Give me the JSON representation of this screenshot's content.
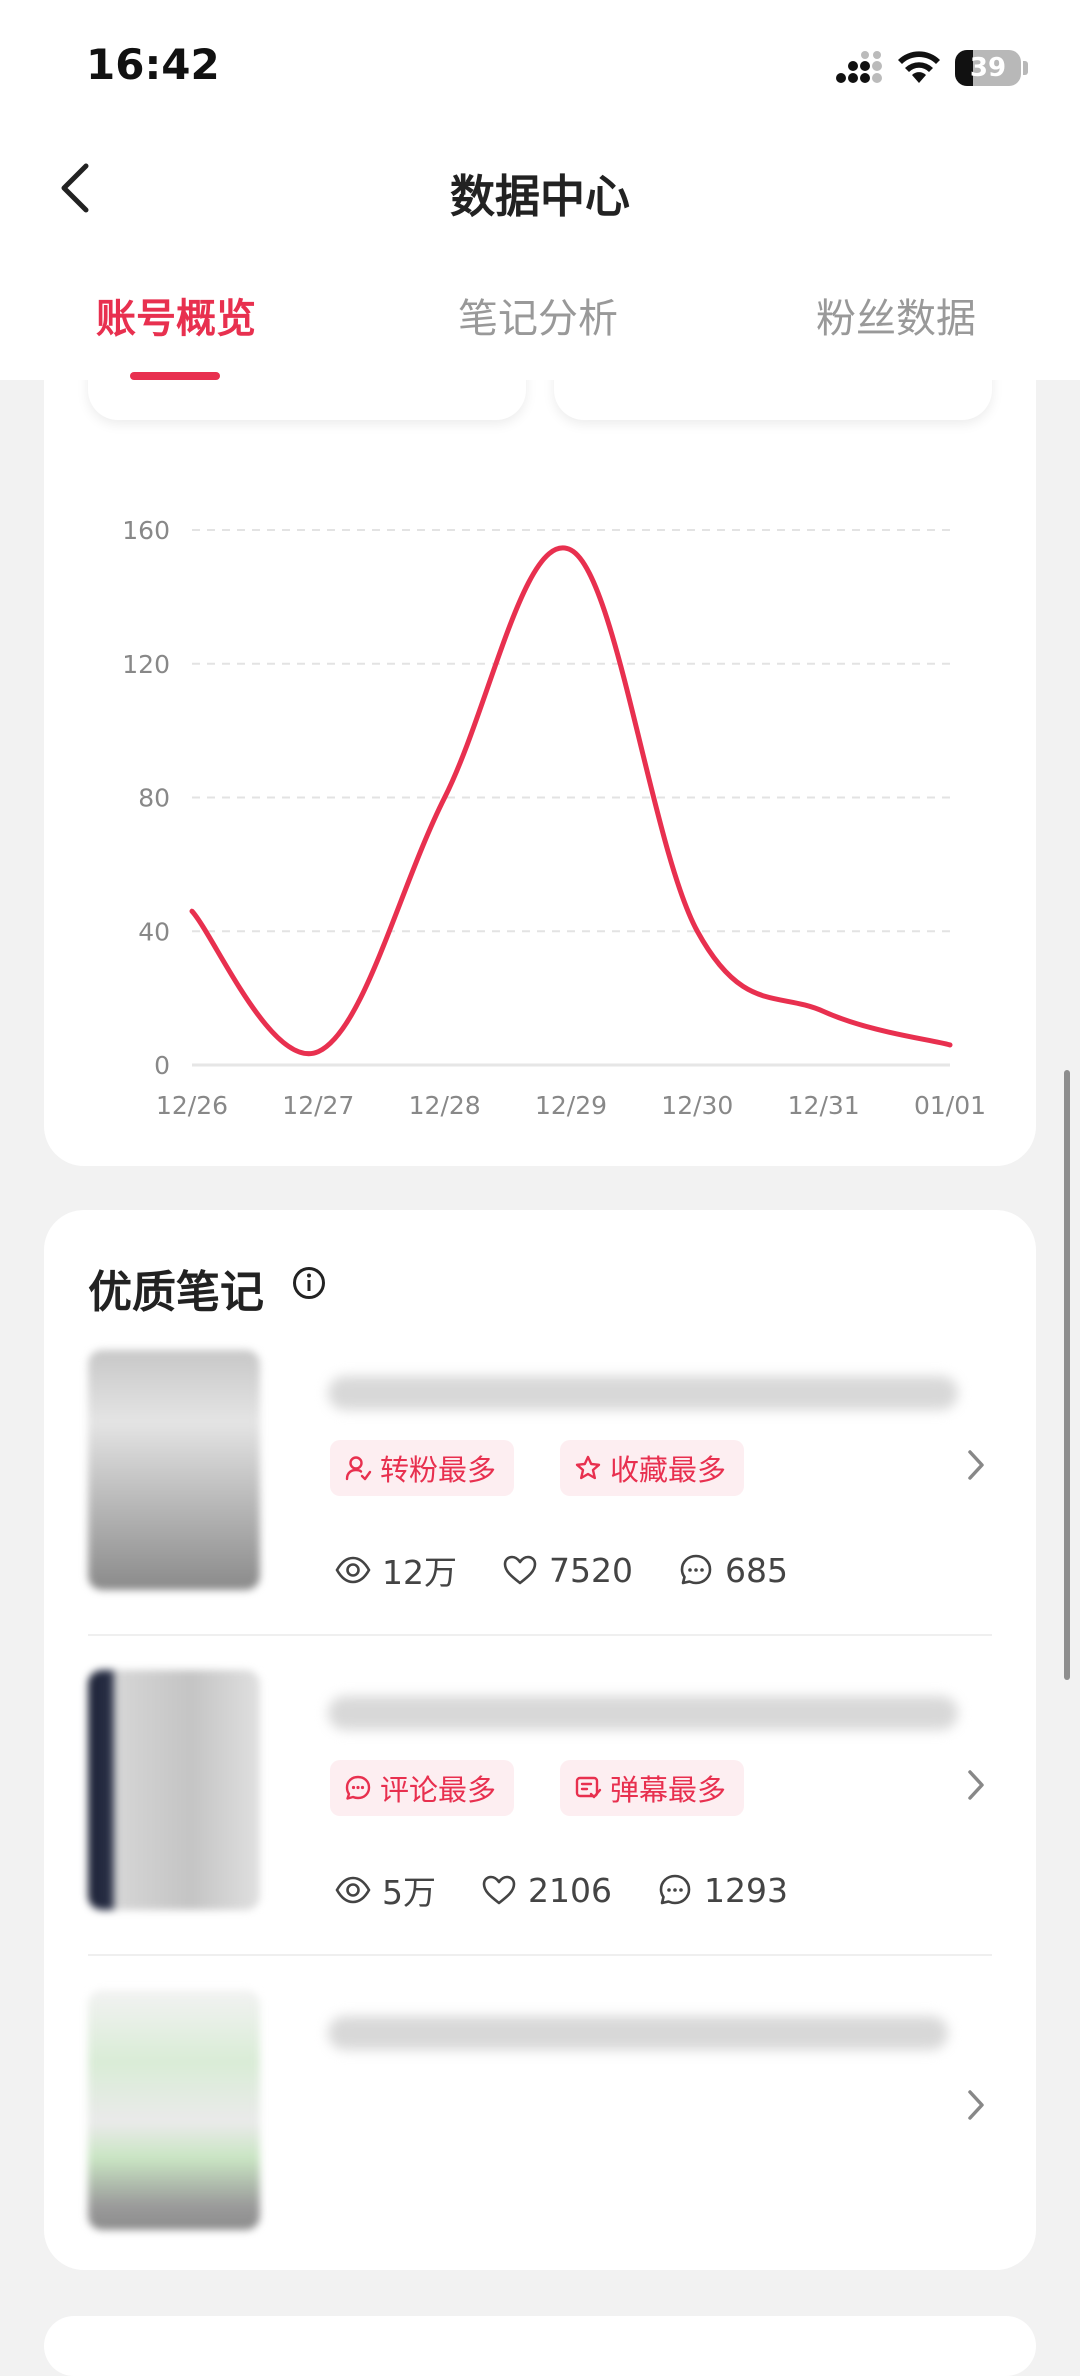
{
  "status_bar": {
    "time": "16:42",
    "battery": "39"
  },
  "header": {
    "title": "数据中心"
  },
  "tabs": [
    {
      "label": "账号概览",
      "active": true
    },
    {
      "label": "笔记分析",
      "active": false
    },
    {
      "label": "粉丝数据",
      "active": false
    }
  ],
  "colors": {
    "accent": "#e8304f",
    "tag_bg": "#fdeef1",
    "bg": "#f2f2f2"
  },
  "chart_data": {
    "type": "line",
    "x": [
      "12/26",
      "12/27",
      "12/28",
      "12/29",
      "12/30",
      "12/31",
      "01/01"
    ],
    "values": [
      46,
      4,
      80,
      154,
      40,
      16,
      6
    ],
    "ylim": [
      0,
      160
    ],
    "yticks": [
      0,
      40,
      80,
      120,
      160
    ],
    "grid": true,
    "color": "#e8304f"
  },
  "quality_notes": {
    "title": "优质笔记",
    "items": [
      {
        "tags": [
          {
            "label": "转粉最多",
            "icon": "user-add-icon"
          },
          {
            "label": "收藏最多",
            "icon": "star-icon"
          }
        ],
        "views": "12万",
        "likes": "7520",
        "comments": "685"
      },
      {
        "tags": [
          {
            "label": "评论最多",
            "icon": "comment-icon"
          },
          {
            "label": "弹幕最多",
            "icon": "danmaku-icon"
          }
        ],
        "views": "5万",
        "likes": "2106",
        "comments": "1293"
      },
      {
        "tags": [],
        "views": "",
        "likes": "",
        "comments": ""
      }
    ]
  }
}
